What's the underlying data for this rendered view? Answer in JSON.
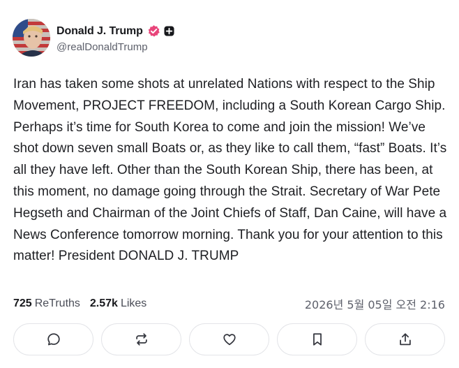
{
  "author": {
    "display_name": "Donald J. Trump",
    "handle": "@realDonaldTrump",
    "avatar_icon": "avatar-image",
    "verified_color": "#e8457a"
  },
  "post": {
    "text": "Iran has taken some shots at unrelated Nations with respect to the Ship Movement, PROJECT FREEDOM, including a South Korean Cargo Ship. Perhaps it’s time for South Korea to come and join the mission! We’ve shot down seven small Boats or, as they like to call them, “fast” Boats. It’s all they have left. Other than the South Korean Ship, there has been, at this moment, no damage going through the Strait. Secretary of War Pete Hegseth and Chairman of the Joint Chiefs of Staff, Dan Caine, will have a News Conference tomorrow morning. Thank you for your attention to this matter! President DONALD J. TRUMP"
  },
  "stats": {
    "retruths_count": "725",
    "retruths_label": "ReTruths",
    "likes_count": "2.57k",
    "likes_label": "Likes",
    "timestamp": "2026년 5월 05일 오전 2:16"
  },
  "actions": [
    {
      "icon": "reply-icon"
    },
    {
      "icon": "retruth-icon"
    },
    {
      "icon": "like-icon"
    },
    {
      "icon": "bookmark-icon"
    },
    {
      "icon": "share-icon"
    }
  ]
}
